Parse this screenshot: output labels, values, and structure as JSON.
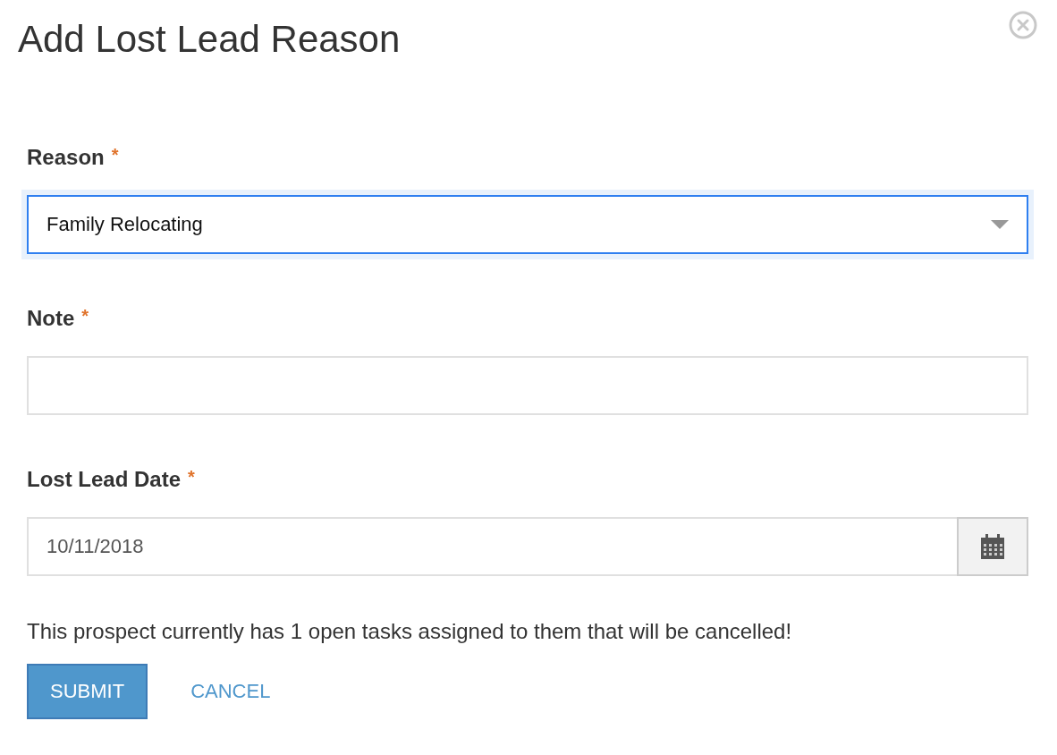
{
  "dialog": {
    "title": "Add Lost Lead Reason"
  },
  "fields": [
    {
      "kind": "select",
      "label": "Reason",
      "required": true,
      "value": "Family Relocating",
      "focused": true
    },
    {
      "kind": "text",
      "label": "Note",
      "required": true,
      "focused": false
    },
    {
      "kind": "date",
      "label": "Lost Lead Date",
      "required": true,
      "value": "10/11/2018",
      "focused": false
    }
  ],
  "required_mark": "*",
  "message": "This prospect currently has 1 open tasks assigned to them that will be cancelled!",
  "buttons": [
    {
      "kind": "primary",
      "label": "SUBMIT"
    },
    {
      "kind": "link",
      "label": "CANCEL"
    }
  ]
}
